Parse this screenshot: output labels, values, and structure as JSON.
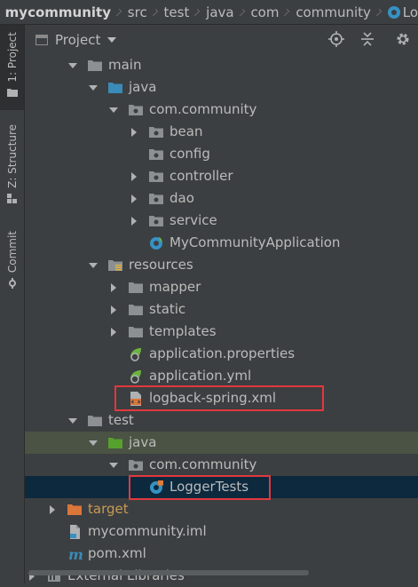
{
  "breadcrumb": [
    "mycommunity",
    "src",
    "test",
    "java",
    "com",
    "community",
    "Lo"
  ],
  "stripe": {
    "project": "1: Project",
    "structure": "Z: Structure",
    "commit": "Commit"
  },
  "panel": {
    "title": "Project"
  },
  "tree": [
    {
      "label": "main",
      "indent": 0,
      "arrow": "down",
      "icon": "folder"
    },
    {
      "label": "java",
      "indent": 1,
      "arrow": "down",
      "icon": "folder-blue"
    },
    {
      "label": "com.community",
      "indent": 2,
      "arrow": "down",
      "icon": "package"
    },
    {
      "label": "bean",
      "indent": 3,
      "arrow": "right",
      "icon": "package"
    },
    {
      "label": "config",
      "indent": 3,
      "arrow": "none",
      "icon": "package"
    },
    {
      "label": "controller",
      "indent": 3,
      "arrow": "right",
      "icon": "package"
    },
    {
      "label": "dao",
      "indent": 3,
      "arrow": "right",
      "icon": "package"
    },
    {
      "label": "service",
      "indent": 3,
      "arrow": "right",
      "icon": "package"
    },
    {
      "label": "MyCommunityApplication",
      "indent": 3,
      "arrow": "none",
      "icon": "spring-class"
    },
    {
      "label": "resources",
      "indent": 1,
      "arrow": "down",
      "icon": "folder-resources"
    },
    {
      "label": "mapper",
      "indent": 2,
      "arrow": "right",
      "icon": "folder"
    },
    {
      "label": "static",
      "indent": 2,
      "arrow": "right",
      "icon": "folder"
    },
    {
      "label": "templates",
      "indent": 2,
      "arrow": "right",
      "icon": "folder"
    },
    {
      "label": "application.properties",
      "indent": 2,
      "arrow": "none",
      "icon": "spring-config"
    },
    {
      "label": "application.yml",
      "indent": 2,
      "arrow": "none",
      "icon": "spring-config"
    },
    {
      "label": "logback-spring.xml",
      "indent": 2,
      "arrow": "none",
      "icon": "xml-file"
    },
    {
      "label": "test",
      "indent": 0,
      "arrow": "down",
      "icon": "folder"
    },
    {
      "label": "java",
      "indent": 1,
      "arrow": "down",
      "icon": "folder-green",
      "bg": "green"
    },
    {
      "label": "com.community",
      "indent": 2,
      "arrow": "down",
      "icon": "package"
    },
    {
      "label": "LoggerTests",
      "indent": 3,
      "arrow": "none",
      "icon": "test-class",
      "bg": "selected"
    },
    {
      "label": "target",
      "indent": -1,
      "arrow": "right",
      "icon": "folder-orange",
      "color": "orange"
    },
    {
      "label": "mycommunity.iml",
      "indent": -1,
      "arrow": "none",
      "icon": "iml-file"
    },
    {
      "label": "pom.xml",
      "indent": -1,
      "arrow": "none",
      "icon": "maven-file"
    },
    {
      "label": "External Libraries",
      "indent": -2,
      "arrow": "right",
      "icon": "library"
    }
  ],
  "colors": {
    "background": "#3c3f41",
    "selected_row": "#0d293e",
    "test_row": "#4a5344",
    "highlight_box": "#e0383e"
  }
}
